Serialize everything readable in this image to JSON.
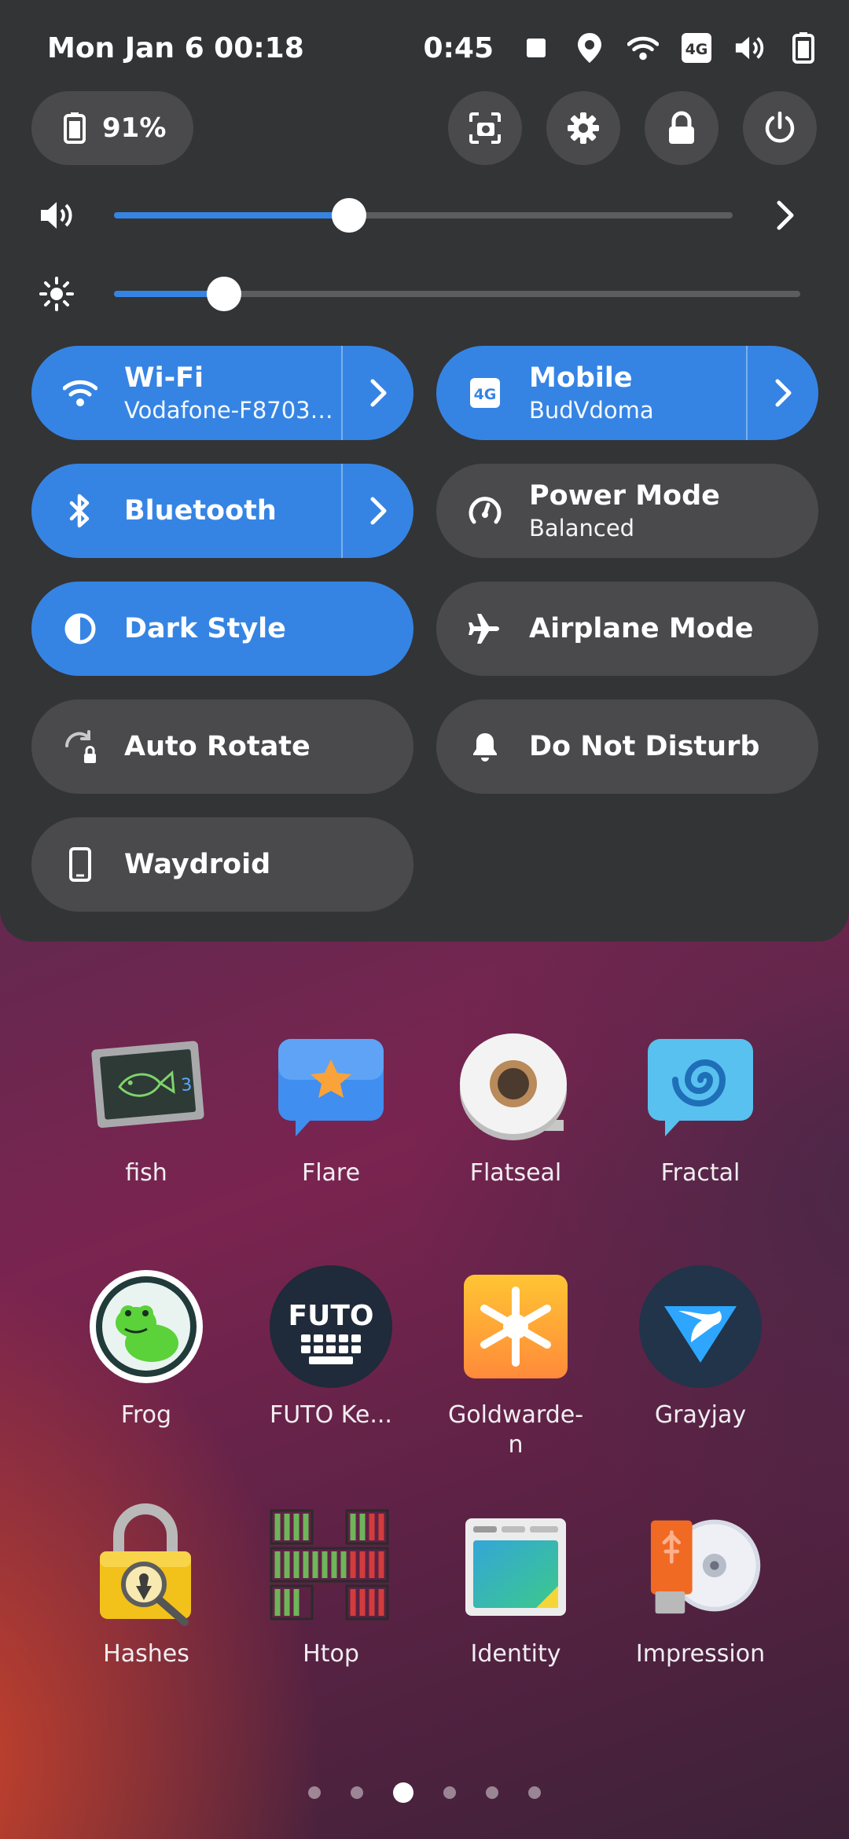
{
  "status_bar": {
    "date_time": "Mon Jan 6  00:18",
    "clock": "0:45",
    "icons": [
      "stop-icon",
      "location-icon",
      "wifi-icon",
      "4g-icon",
      "volume-icon",
      "battery-icon"
    ]
  },
  "quick_settings": {
    "battery_percent": "91%",
    "actions": [
      "screenshot-icon",
      "settings-icon",
      "lock-icon",
      "power-icon"
    ],
    "volume_level": 0.38,
    "brightness_level": 0.16,
    "tiles": [
      {
        "title": "Wi-Fi",
        "subtitle": "Vodafone-F87037...",
        "active": true,
        "icon": "wifi-icon",
        "has_menu": true
      },
      {
        "title": "Mobile",
        "subtitle": "BudVdoma",
        "active": true,
        "icon": "4g-icon",
        "has_menu": true
      },
      {
        "title": "Bluetooth",
        "subtitle": "",
        "active": true,
        "icon": "bluetooth-icon",
        "has_menu": true
      },
      {
        "title": "Power Mode",
        "subtitle": "Balanced",
        "active": false,
        "icon": "power-mode-icon",
        "has_menu": false
      },
      {
        "title": "Dark Style",
        "subtitle": "",
        "active": true,
        "icon": "dark-style-icon",
        "has_menu": false
      },
      {
        "title": "Airplane Mode",
        "subtitle": "",
        "active": false,
        "icon": "airplane-icon",
        "has_menu": false
      },
      {
        "title": "Auto Rotate",
        "subtitle": "",
        "active": false,
        "icon": "rotate-lock-icon",
        "has_menu": false
      },
      {
        "title": "Do Not Disturb",
        "subtitle": "",
        "active": false,
        "icon": "bell-icon",
        "has_menu": false
      },
      {
        "title": "Waydroid",
        "subtitle": "",
        "active": false,
        "icon": "phone-icon",
        "has_menu": false
      }
    ]
  },
  "apps": [
    {
      "name": "fish",
      "icon": "fish-icon"
    },
    {
      "name": "Flare",
      "icon": "flare-icon"
    },
    {
      "name": "Flatseal",
      "icon": "flatseal-icon"
    },
    {
      "name": "Fractal",
      "icon": "fractal-icon"
    },
    {
      "name": "Frog",
      "icon": "frog-icon"
    },
    {
      "name": "FUTO Ke...",
      "icon": "futo-keyboard-icon",
      "icon_text": "FUTO"
    },
    {
      "name": "Goldwarde-\nn",
      "icon": "goldwarden-icon"
    },
    {
      "name": "Grayjay",
      "icon": "grayjay-icon"
    },
    {
      "name": "Hashes",
      "icon": "hashes-icon"
    },
    {
      "name": "Htop",
      "icon": "htop-icon"
    },
    {
      "name": "Identity",
      "icon": "identity-icon"
    },
    {
      "name": "Impression",
      "icon": "impression-icon"
    }
  ],
  "pager": {
    "pages": 6,
    "current": 3
  },
  "colors": {
    "accent": "#3584e4",
    "panel": "#333436",
    "tile_off": "#4a4a4c"
  }
}
